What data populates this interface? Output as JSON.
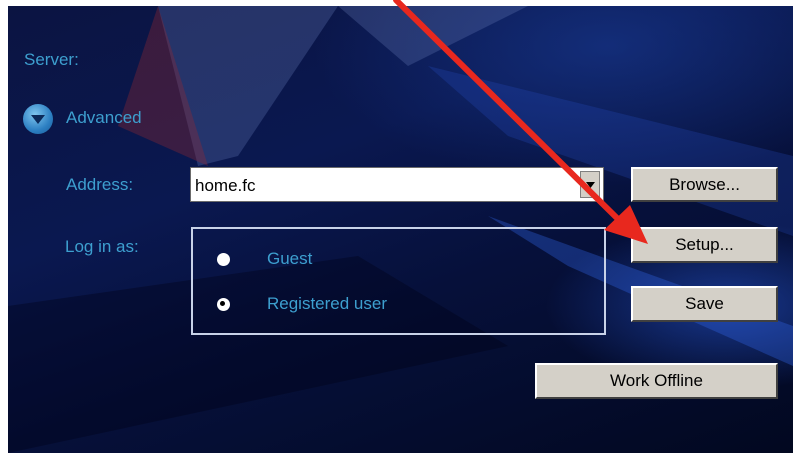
{
  "server": {
    "label": "Server:",
    "advanced_label": "Advanced"
  },
  "address": {
    "label": "Address:",
    "value": "home.fc"
  },
  "login": {
    "label": "Log in as:",
    "options": [
      "Guest",
      "Registered user"
    ],
    "selected": "Registered user"
  },
  "buttons": {
    "browse": "Browse...",
    "setup": "Setup...",
    "save": "Save",
    "work_offline": "Work Offline"
  },
  "colors": {
    "label_text": "#3d9fcf",
    "button_face": "#d4d0c8",
    "annotation_arrow": "#e8281e",
    "background_dark": "#06103a"
  },
  "icons": {
    "advanced_toggle": "chevron-down-circle-icon",
    "combo_dropdown": "chevron-down-icon",
    "annotation": "red-arrow-annotation"
  }
}
